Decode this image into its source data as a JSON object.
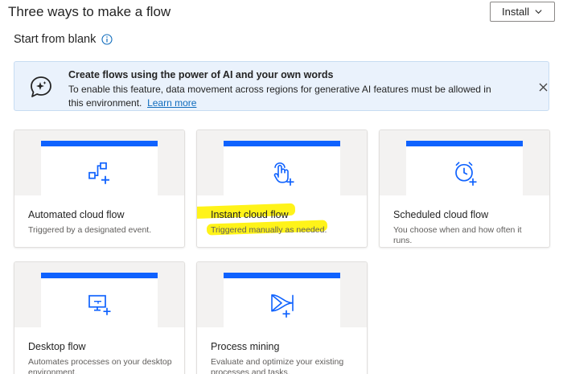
{
  "header": {
    "title": "Three ways to make a flow",
    "install_label": "Install"
  },
  "section": {
    "title": "Start from blank"
  },
  "banner": {
    "title": "Create flows using the power of AI and your own words",
    "body": "To enable this feature, data movement across regions for generative AI features must be allowed in this environment.",
    "link": "Learn more"
  },
  "cards": [
    {
      "title": "Automated cloud flow",
      "description": "Triggered by a designated event.",
      "icon": "automated-flow-icon"
    },
    {
      "title": "Instant cloud flow",
      "description": "Triggered manually as needed.",
      "icon": "touch-hand-icon",
      "highlighted": true
    },
    {
      "title": "Scheduled cloud flow",
      "description": "You choose when and how often it runs.",
      "icon": "alarm-clock-icon"
    },
    {
      "title": "Desktop flow",
      "description": "Automates processes on your desktop environment.",
      "icon": "desktop-flow-icon"
    },
    {
      "title": "Process mining",
      "description": "Evaluate and optimize your existing processes and tasks.",
      "icon": "process-mining-icon"
    }
  ],
  "colors": {
    "accent": "#0f62fe",
    "link": "#0f6cbd",
    "banner_bg": "#eaf2fc",
    "highlight": "#fff200"
  }
}
